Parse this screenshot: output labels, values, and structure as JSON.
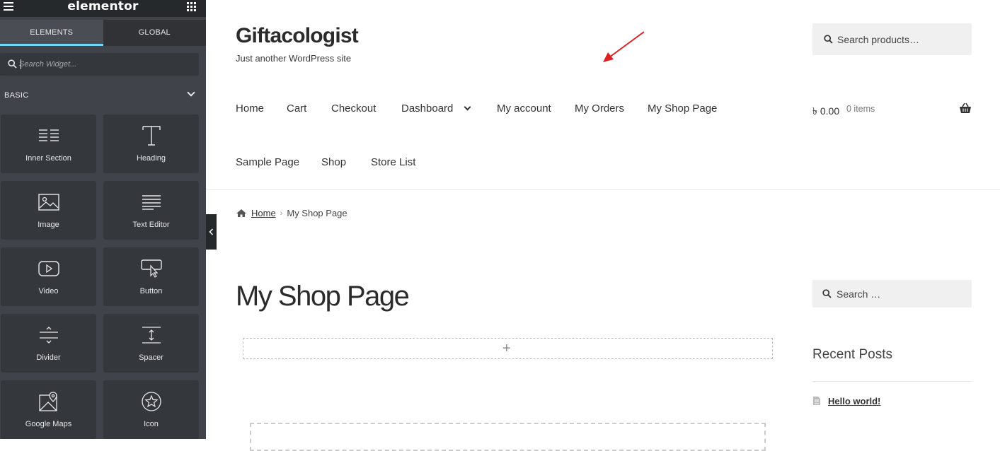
{
  "panel": {
    "logo": "elementor",
    "tabs": [
      {
        "label": "ELEMENTS",
        "active": true
      },
      {
        "label": "GLOBAL",
        "active": false
      }
    ],
    "search": {
      "placeholder": "Search Widget..."
    },
    "category": "BASIC",
    "widgets": [
      {
        "label": "Inner Section",
        "icon": "inner-section-icon"
      },
      {
        "label": "Heading",
        "icon": "heading-icon"
      },
      {
        "label": "Image",
        "icon": "image-icon"
      },
      {
        "label": "Text Editor",
        "icon": "text-editor-icon"
      },
      {
        "label": "Video",
        "icon": "video-icon"
      },
      {
        "label": "Button",
        "icon": "button-icon"
      },
      {
        "label": "Divider",
        "icon": "divider-icon"
      },
      {
        "label": "Spacer",
        "icon": "spacer-icon"
      },
      {
        "label": "Google Maps",
        "icon": "google-maps-icon"
      },
      {
        "label": "Icon",
        "icon": "star-icon"
      }
    ],
    "colors": {
      "panel_bg": "#404349",
      "accent": "#71d7f7"
    }
  },
  "site": {
    "title": "Giftacologist",
    "tagline": "Just another WordPress site",
    "product_search": {
      "placeholder": "Search products…"
    },
    "nav": {
      "home": "Home",
      "cart": "Cart",
      "checkout": "Checkout",
      "dashboard": "Dashboard",
      "my_account": "My account",
      "my_orders": "My Orders",
      "my_shop_page": "My Shop Page",
      "sample_page": "Sample Page",
      "shop": "Shop",
      "store_list": "Store List"
    },
    "cart": {
      "total": "৳ 0.00",
      "count": "0 items"
    },
    "breadcrumb": {
      "home": "Home",
      "separator": "›",
      "current": "My Shop Page"
    },
    "page_title": "My Shop Page",
    "add_section_symbol": "+",
    "sidebar": {
      "search_placeholder": "Search …",
      "recent_posts_title": "Recent Posts",
      "posts": [
        "Hello world!"
      ]
    },
    "annotation_arrow_color": "#e02020"
  }
}
